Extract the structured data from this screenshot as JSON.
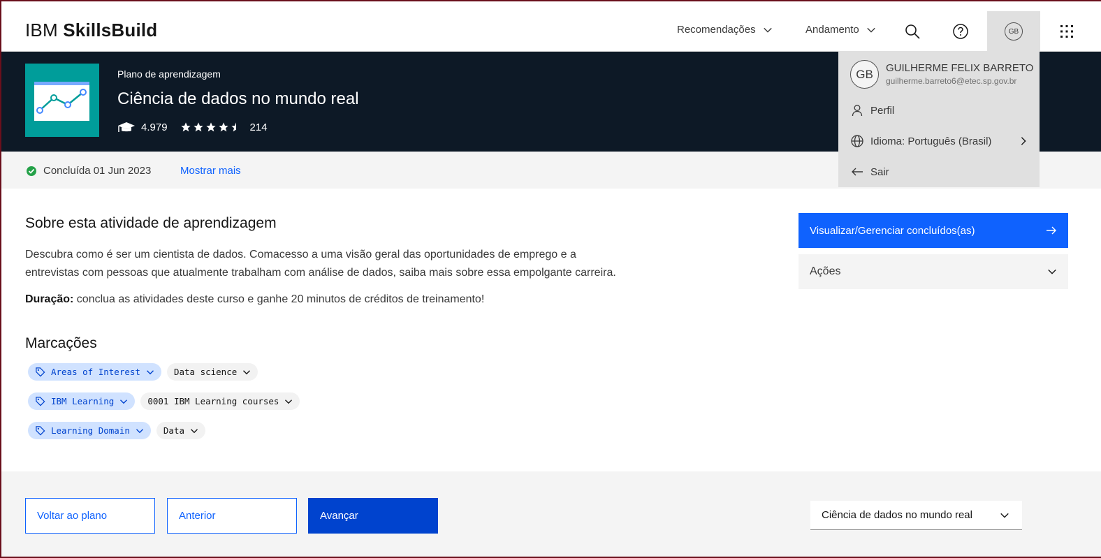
{
  "header": {
    "brand_light": "IBM",
    "brand_bold": "SkillsBuild",
    "nav_recommendations": "Recomendações",
    "nav_progress": "Andamento",
    "avatar_initials": "GB"
  },
  "course": {
    "plan_label": "Plano de aprendizagem",
    "title": "Ciência de dados no mundo real",
    "learners": "4.979",
    "rating_stars": 4.5,
    "rating_count": "214"
  },
  "status": {
    "completed_text": "Concluída 01 Jun 2023",
    "show_more": "Mostrar mais"
  },
  "about": {
    "heading": "Sobre esta atividade de aprendizagem",
    "description_line1": "Descubra como é ser um cientista de dados. Comacesso a uma visão geral das oportunidades de emprego e a",
    "description_line2": "entrevistas com pessoas que atualmente trabalham com análise de dados, saiba mais sobre essa empolgante carreira.",
    "duration_label": "Duração:",
    "duration_text": " conclua as atividades deste curso e ganhe 20 minutos de créditos de treinamento!"
  },
  "tags": {
    "heading": "Marcações",
    "rows": [
      {
        "category": "Areas of Interest",
        "value": "Data science"
      },
      {
        "category": "IBM Learning",
        "value": "0001 IBM Learning courses"
      },
      {
        "category": "Learning Domain",
        "value": "Data"
      }
    ]
  },
  "actions": {
    "primary": "Visualizar/Gerenciar concluídos(as)",
    "dropdown": "Ações"
  },
  "footer": {
    "back_to_plan": "Voltar ao plano",
    "previous": "Anterior",
    "next": "Avançar",
    "select_value": "Ciência de dados no mundo real"
  },
  "account_menu": {
    "initials": "GB",
    "name": "GUILHERME FELIX BARRETO",
    "email": "guilherme.barreto6@etec.sp.gov.br",
    "profile": "Perfil",
    "language": "Idioma: Português (Brasil)",
    "logout": "Sair"
  },
  "colors": {
    "primary_blue": "#0f62fe",
    "dark_blue": "#0043ce",
    "banner_bg": "#0d1926",
    "thumbnail_teal": "#009d9a",
    "success_green": "#24a148",
    "tag_blue_bg": "#d0e2ff"
  }
}
